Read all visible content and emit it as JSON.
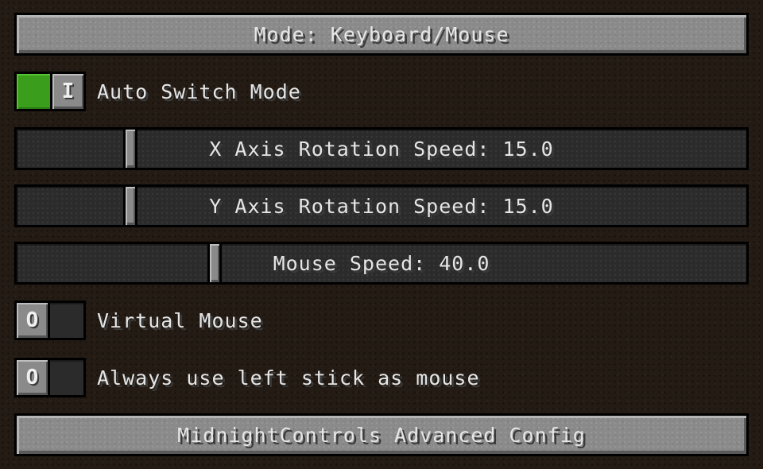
{
  "mode_button": {
    "label": "Mode: Keyboard/Mouse"
  },
  "auto_switch": {
    "label": "Auto Switch Mode",
    "state": true,
    "knob": "I"
  },
  "x_axis_slider": {
    "label": "X Axis Rotation Speed: 15.0",
    "value": 15.0
  },
  "y_axis_slider": {
    "label": "Y Axis Rotation Speed: 15.0",
    "value": 15.0
  },
  "mouse_speed_slider": {
    "label": "Mouse Speed: 40.0",
    "value": 40.0
  },
  "virtual_mouse": {
    "label": "Virtual Mouse",
    "state": false,
    "knob": "O"
  },
  "left_stick_mouse": {
    "label": "Always use left stick as mouse",
    "state": false,
    "knob": "O"
  },
  "advanced_button": {
    "label": "MidnightControls Advanced Config"
  },
  "colors": {
    "background": "#231b14",
    "button": "#8a8a8a",
    "toggle_on": "#3a9e1c",
    "text": "#e6e6e6"
  }
}
